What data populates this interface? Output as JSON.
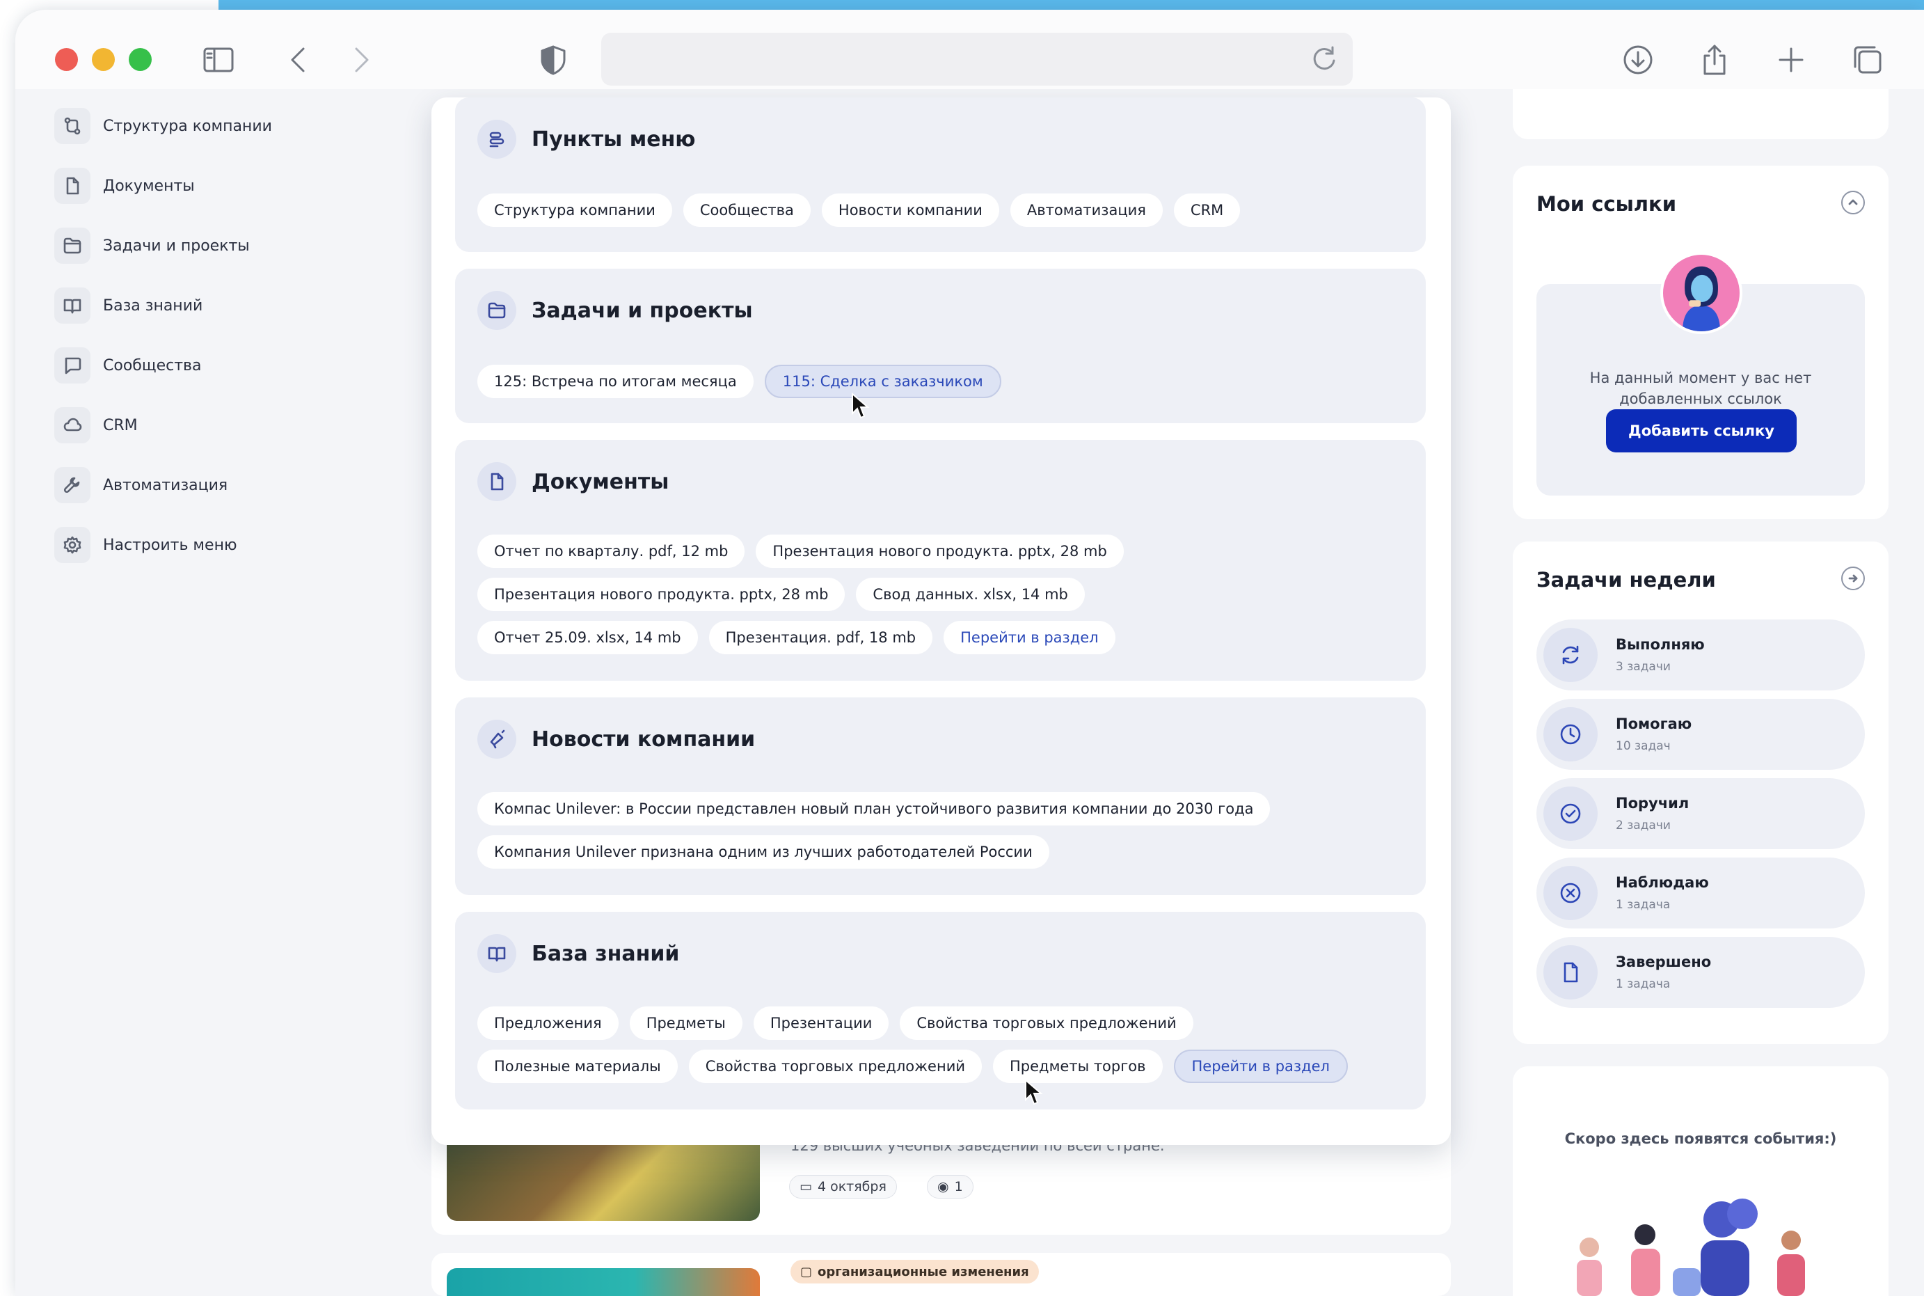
{
  "sidebar": {
    "items": [
      {
        "label": "Структура компании",
        "icon": "org-structure-icon"
      },
      {
        "label": "Документы",
        "icon": "document-icon"
      },
      {
        "label": "Задачи и проекты",
        "icon": "folder-icon"
      },
      {
        "label": "База знаний",
        "icon": "book-icon"
      },
      {
        "label": "Сообщества",
        "icon": "chat-icon"
      },
      {
        "label": "CRM",
        "icon": "cloud-icon"
      },
      {
        "label": "Автоматизация",
        "icon": "wrench-icon"
      },
      {
        "label": "Настроить меню",
        "icon": "gear-icon"
      }
    ]
  },
  "panel": {
    "menu_items": {
      "title": "Пункты меню",
      "chips": [
        "Структура компании",
        "Сообщества",
        "Новости компании",
        "Автоматизация",
        "CRM"
      ]
    },
    "tasks": {
      "title": "Задачи и проекты",
      "chips": [
        "125: Встреча по итогам месяца",
        "115: Сделка с заказчиком"
      ]
    },
    "documents": {
      "title": "Документы",
      "chips": [
        "Отчет по кварталу. pdf, 12 mb",
        "Презентация нового продукта. pptx, 28 mb",
        "Презентация нового продукта. pptx, 28 mb",
        "Свод данных. xlsx, 14 mb",
        "Отчет 25.09. xlsx, 14 mb",
        "Презентация. pdf, 18 mb"
      ],
      "link": "Перейти в раздел"
    },
    "news": {
      "title": "Новости компании",
      "chips": [
        "Компас Unilever: в России представлен новый план устойчивого развития компании до 2030 года",
        "Компания Unilever признана одним из лучших работодателей России"
      ]
    },
    "knowledge": {
      "title": "База знаний",
      "chips": [
        "Предложения",
        "Предметы",
        "Презентации",
        "Свойства торговых предложений",
        "Полезные материалы",
        "Свойства торговых предложений",
        "Предметы торгов"
      ],
      "link": "Перейти в раздел"
    }
  },
  "feed": {
    "post1_text": "129 высших учебных заведений по всей стране.",
    "post1_date": "4 октября",
    "post1_views": "1",
    "post2_tag": "организационные изменения"
  },
  "links_card": {
    "title": "Мои ссылки",
    "empty_text": "На данный момент у вас нет добавленных ссылок",
    "button": "Добавить ссылку"
  },
  "week_tasks": {
    "title": "Задачи недели",
    "items": [
      {
        "name": "Выполняю",
        "count": "3 задачи"
      },
      {
        "name": "Помогаю",
        "count": "10 задач"
      },
      {
        "name": "Поручил",
        "count": "2 задачи"
      },
      {
        "name": "Наблюдаю",
        "count": "1 задача"
      },
      {
        "name": "Завершено",
        "count": "1 задача"
      }
    ]
  },
  "events": {
    "text": "Скоро здесь появятся события:)"
  },
  "colors": {
    "accent": "#0c2bb8",
    "link": "#2a48b8",
    "section_bg": "#eef0f6"
  }
}
